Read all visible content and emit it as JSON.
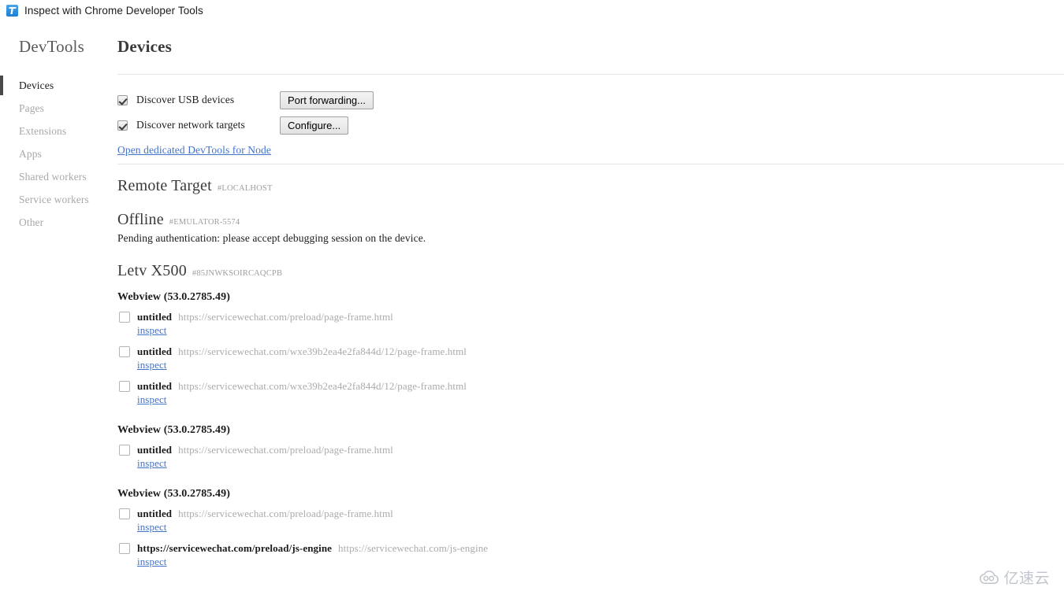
{
  "window": {
    "title": "Inspect with Chrome Developer Tools",
    "icon": "devtools-app-icon"
  },
  "sidebar": {
    "title": "DevTools",
    "items": [
      {
        "label": "Devices",
        "selected": true
      },
      {
        "label": "Pages",
        "selected": false
      },
      {
        "label": "Extensions",
        "selected": false
      },
      {
        "label": "Apps",
        "selected": false
      },
      {
        "label": "Shared workers",
        "selected": false
      },
      {
        "label": "Service workers",
        "selected": false
      },
      {
        "label": "Other",
        "selected": false
      }
    ]
  },
  "main": {
    "page_title": "Devices",
    "discovery": {
      "usb": {
        "label": "Discover USB devices",
        "checked": true
      },
      "network": {
        "label": "Discover network targets",
        "checked": true
      },
      "port_forwarding_button": "Port forwarding...",
      "configure_button": "Configure...",
      "node_link": "Open dedicated DevTools for Node"
    },
    "remote_target": {
      "name": "Remote Target",
      "serial": "#LOCALHOST"
    },
    "devices": [
      {
        "name": "Offline",
        "serial": "#EMULATOR-5574",
        "status": "Pending authentication: please accept debugging session on the device.",
        "browsers": []
      },
      {
        "name": "Letv X500",
        "serial": "#85JNWKSOIRCAQCPB",
        "status": "",
        "browsers": [
          {
            "name": "Webview (53.0.2785.49)",
            "targets": [
              {
                "title": "untitled",
                "url": "https://servicewechat.com/preload/page-frame.html",
                "action": "inspect"
              },
              {
                "title": "untitled",
                "url": "https://servicewechat.com/wxe39b2ea4e2fa844d/12/page-frame.html",
                "action": "inspect"
              },
              {
                "title": "untitled",
                "url": "https://servicewechat.com/wxe39b2ea4e2fa844d/12/page-frame.html",
                "action": "inspect"
              }
            ]
          },
          {
            "name": "Webview (53.0.2785.49)",
            "targets": [
              {
                "title": "untitled",
                "url": "https://servicewechat.com/preload/page-frame.html",
                "action": "inspect"
              }
            ]
          },
          {
            "name": "Webview (53.0.2785.49)",
            "targets": [
              {
                "title": "untitled",
                "url": "https://servicewechat.com/preload/page-frame.html",
                "action": "inspect"
              },
              {
                "title": "https://servicewechat.com/preload/js-engine",
                "url": "https://servicewechat.com/js-engine",
                "action": "inspect"
              }
            ]
          }
        ]
      }
    ]
  },
  "watermark": {
    "text": "亿速云",
    "icon": "cloud-icon"
  },
  "colors": {
    "link": "#4273c8",
    "selected_bar": "#4a4a4a",
    "muted_text": "#ababab",
    "divider": "#e6e6e6",
    "accent": "#1a7fd4"
  }
}
